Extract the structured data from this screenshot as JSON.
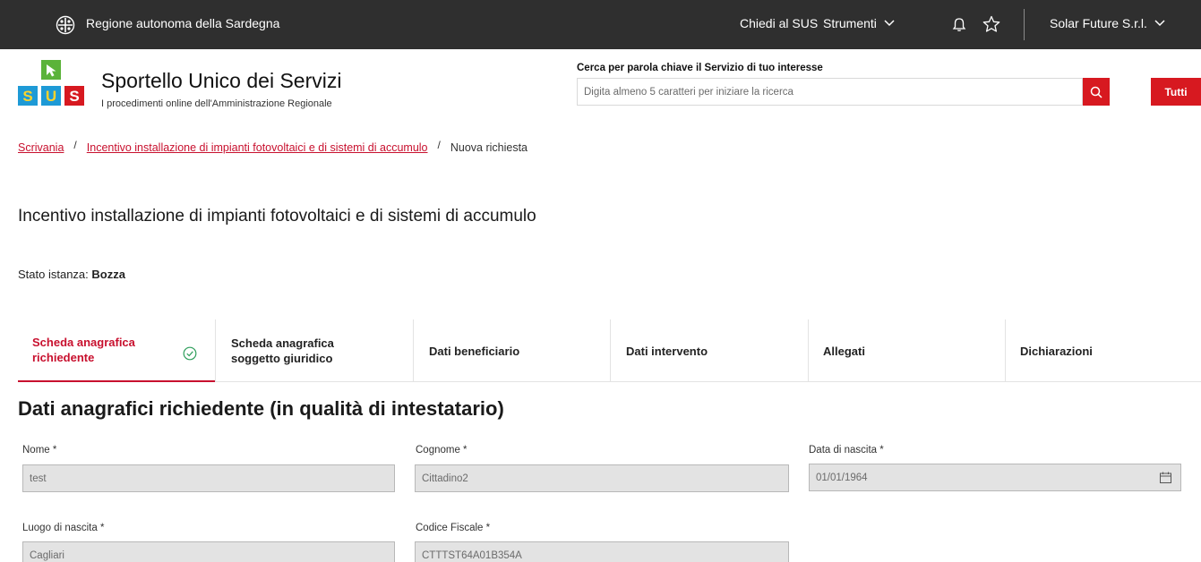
{
  "topbar": {
    "region": "Regione autonoma della Sardegna",
    "chiedi": "Chiedi al SUS",
    "strumenti": "Strumenti",
    "company": "Solar Future S.r.l."
  },
  "header": {
    "logo_letters": [
      "S",
      "U",
      "S"
    ],
    "title": "Sportello Unico dei Servizi",
    "subtitle": "I procedimenti online dell'Amministrazione Regionale",
    "search_label": "Cerca per parola chiave il Servizio di tuo interesse",
    "search_placeholder": "Digita almeno 5 caratteri per iniziare la ricerca",
    "tutti_label": "Tutti"
  },
  "breadcrumb": {
    "items": [
      "Scrivania",
      "Incentivo installazione di impianti fotovoltaici e di sistemi di accumulo"
    ],
    "current": "Nuova richiesta",
    "separator": "/"
  },
  "page": {
    "title": "Incentivo installazione di impianti fotovoltaici e di sistemi di accumulo",
    "stato_label": "Stato istanza: ",
    "stato_value": "Bozza"
  },
  "tabs": [
    {
      "label": "Scheda anagrafica richiedente",
      "active": true,
      "completed": true
    },
    {
      "label": "Scheda anagrafica soggetto giuridico",
      "active": false
    },
    {
      "label": "Dati beneficiario",
      "active": false
    },
    {
      "label": "Dati intervento",
      "active": false
    },
    {
      "label": "Allegati",
      "active": false
    },
    {
      "label": "Dichiarazioni",
      "active": false
    }
  ],
  "form": {
    "section_title": "Dati anagrafici richiedente (in qualità di intestatario)",
    "nome_label": "Nome *",
    "nome_value": "test",
    "cognome_label": "Cognome *",
    "cognome_value": "Cittadino2",
    "data_label": "Data di nascita *",
    "data_value": "01/01/1964",
    "luogo_label": "Luogo di nascita *",
    "luogo_value": "Cagliari",
    "cf_label": "Codice Fiscale *",
    "cf_value": "CTTTST64A01B354A"
  },
  "colors": {
    "accent": "#d71920",
    "topbar": "#2f2f2f",
    "link": "#c8102e",
    "check": "#2e9e5b"
  },
  "icons": [
    "emblem-icon",
    "chevron-down-icon",
    "bell-icon",
    "star-icon",
    "search-icon",
    "check-circle-icon",
    "calendar-icon"
  ]
}
